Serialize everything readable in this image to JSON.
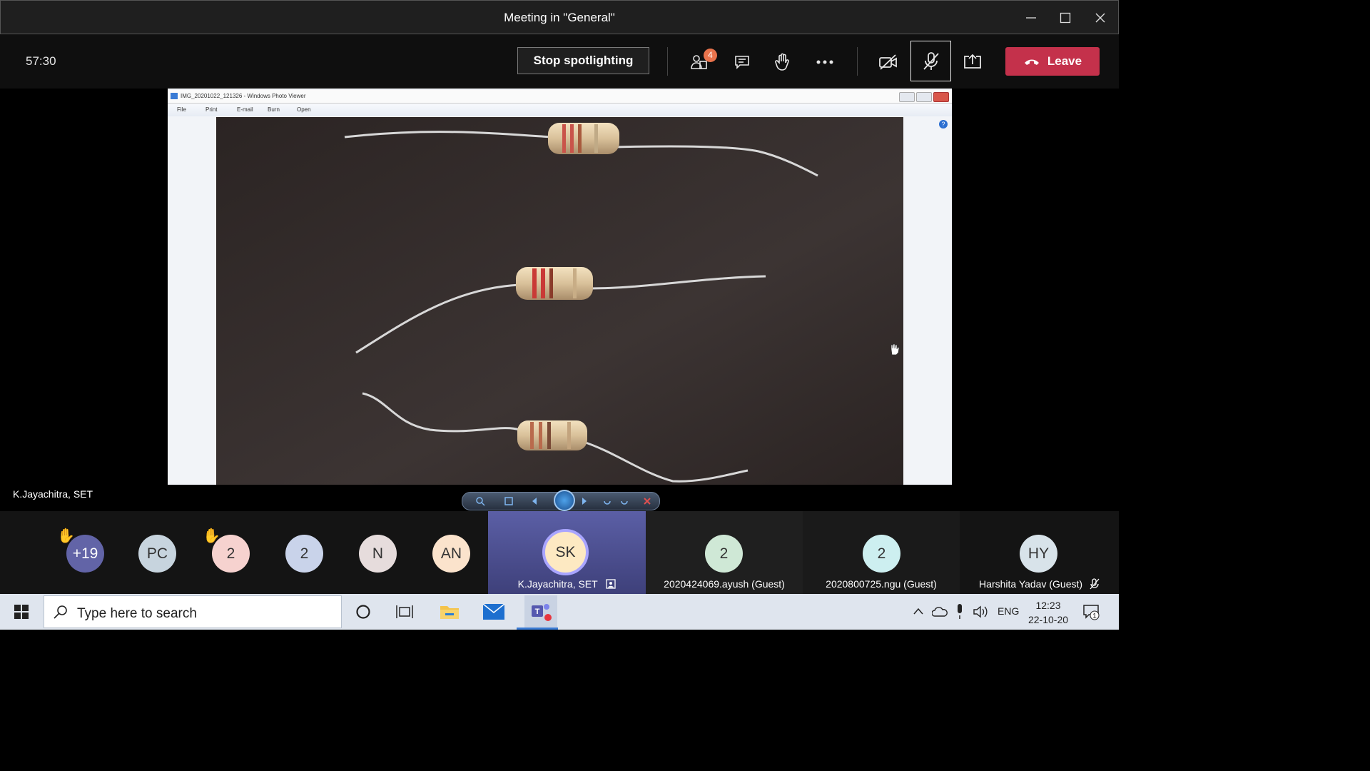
{
  "window": {
    "title": "Meeting in \"General\""
  },
  "controls": {
    "timer": "57:30",
    "stop_spotlight_label": "Stop spotlighting",
    "participants_badge": "4",
    "leave_label": "Leave"
  },
  "shared_screen": {
    "viewer_title": "IMG_20201022_121326 - Windows Photo Viewer",
    "menu": [
      "File",
      "Print",
      "E-mail",
      "Burn",
      "Open"
    ],
    "help_label": "?",
    "presenter_name": "K.Jayachitra, SET"
  },
  "participants": [
    {
      "initials": "+19",
      "hand_raised": true,
      "color": "#6264a7",
      "text_color": "#ffffff"
    },
    {
      "initials": "PC",
      "hand_raised": false,
      "color": "#c7d4de"
    },
    {
      "initials": "2",
      "hand_raised": true,
      "color": "#f6d2cf"
    },
    {
      "initials": "2",
      "hand_raised": false,
      "color": "#c9d3ea"
    },
    {
      "initials": "N",
      "hand_raised": false,
      "color": "#e6dcdc"
    },
    {
      "initials": "AN",
      "hand_raised": false,
      "color": "#fbe3cc"
    }
  ],
  "tiles": [
    {
      "initials": "SK",
      "name": "K.Jayachitra, SET",
      "color": "#fde9c2",
      "active": true
    },
    {
      "initials": "2",
      "name": "2020424069.ayush (Guest)",
      "color": "#cfe8d6"
    },
    {
      "initials": "2",
      "name": "2020800725.ngu (Guest)",
      "color": "#cdeff0"
    },
    {
      "initials": "HY",
      "name": "Harshita Yadav (Guest)",
      "color": "#d8e3ea"
    }
  ],
  "taskbar": {
    "search_placeholder": "Type here to search",
    "language": "ENG",
    "time": "12:23",
    "date": "22-10-20",
    "notification_count": "1"
  },
  "colors": {
    "leave": "#c4314b",
    "accent": "#6264a7"
  }
}
